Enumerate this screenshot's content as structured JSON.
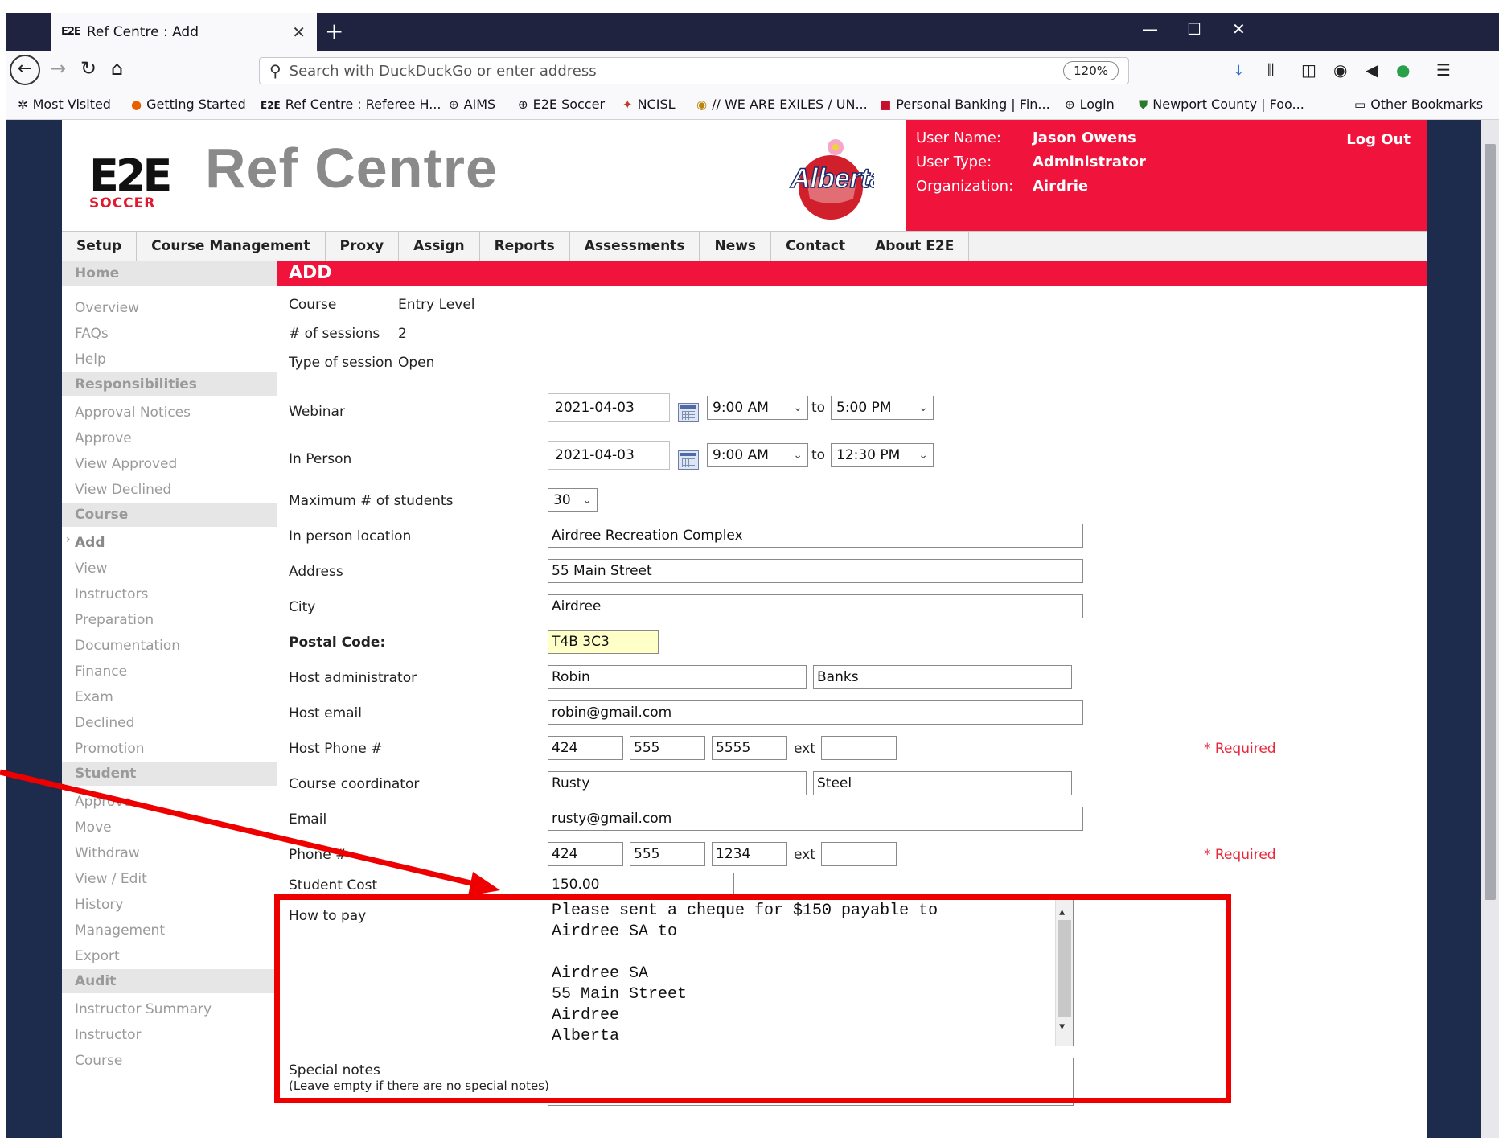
{
  "browser": {
    "tab_title": "Ref Centre : Add",
    "tab_favicon": "E2E",
    "url_placeholder": "Search with DuckDuckGo or enter address",
    "zoom": "120%",
    "bookmarks": [
      {
        "icon": "gear-icon",
        "label": "Most Visited"
      },
      {
        "icon": "firefox-icon",
        "label": "Getting Started"
      },
      {
        "icon": "e2e-icon",
        "label": "Ref Centre : Referee H..."
      },
      {
        "icon": "globe-icon",
        "label": "AIMS"
      },
      {
        "icon": "globe-icon",
        "label": "E2E Soccer"
      },
      {
        "icon": "ncisl-icon",
        "label": "NCISL"
      },
      {
        "icon": "exiles-icon",
        "label": "// WE ARE EXILES / UN..."
      },
      {
        "icon": "cibc-icon",
        "label": "Personal Banking | Fin..."
      },
      {
        "icon": "globe-icon",
        "label": "Login"
      },
      {
        "icon": "shield-icon",
        "label": "Newport County | Foo..."
      }
    ],
    "other_bookmarks": "Other Bookmarks"
  },
  "header": {
    "logo_letters": "E2E",
    "logo_sub": "SOCCER",
    "app_name": "Ref Centre",
    "province_logo": "Alberta",
    "user_name_label": "User Name:",
    "user_name": "Jason Owens",
    "user_type_label": "User Type:",
    "user_type": "Administrator",
    "org_label": "Organization:",
    "org": "Airdrie",
    "logout": "Log Out"
  },
  "nav": [
    "Setup",
    "Course Management",
    "Proxy",
    "Assign",
    "Reports",
    "Assessments",
    "News",
    "Contact",
    "About E2E"
  ],
  "sidebar": {
    "home": "Home",
    "items": [
      {
        "type": "item",
        "label": "Overview"
      },
      {
        "type": "item",
        "label": "FAQs"
      },
      {
        "type": "item",
        "label": "Help"
      },
      {
        "type": "header",
        "label": "Responsibilities"
      },
      {
        "type": "item",
        "label": "Approval Notices"
      },
      {
        "type": "item",
        "label": "Approve"
      },
      {
        "type": "item",
        "label": "View Approved"
      },
      {
        "type": "item",
        "label": "View Declined"
      },
      {
        "type": "header",
        "label": "Course"
      },
      {
        "type": "current",
        "label": "Add"
      },
      {
        "type": "item",
        "label": "View"
      },
      {
        "type": "item",
        "label": "Instructors"
      },
      {
        "type": "item",
        "label": "Preparation"
      },
      {
        "type": "item",
        "label": "Documentation"
      },
      {
        "type": "item",
        "label": "Finance"
      },
      {
        "type": "item",
        "label": "Exam"
      },
      {
        "type": "item",
        "label": "Declined"
      },
      {
        "type": "item",
        "label": "Promotion"
      },
      {
        "type": "header",
        "label": "Student"
      },
      {
        "type": "item",
        "label": "Approve"
      },
      {
        "type": "item",
        "label": "Move"
      },
      {
        "type": "item",
        "label": "Withdraw"
      },
      {
        "type": "item",
        "label": "View / Edit"
      },
      {
        "type": "item",
        "label": "History"
      },
      {
        "type": "item",
        "label": "Management"
      },
      {
        "type": "item",
        "label": "Export"
      },
      {
        "type": "header",
        "label": "Audit"
      },
      {
        "type": "item",
        "label": "Instructor Summary"
      },
      {
        "type": "item",
        "label": "Instructor"
      },
      {
        "type": "item",
        "label": "Course"
      }
    ]
  },
  "page_title": "ADD",
  "form": {
    "course_label": "Course",
    "course": "Entry Level",
    "sessions_label": "# of sessions",
    "sessions": "2",
    "session_type_label": "Type of session",
    "session_type": "Open",
    "webinar_label": "Webinar",
    "webinar_date": "2021-04-03",
    "webinar_from": "9:00 AM",
    "webinar_to": "5:00 PM",
    "to": "to",
    "inperson_label": "In Person",
    "inperson_date": "2021-04-03",
    "inperson_from": "9:00 AM",
    "inperson_to": "12:30 PM",
    "max_label": "Maximum # of students",
    "max": "30",
    "location_label": "In person location",
    "location": "Airdree Recreation Complex",
    "address_label": "Address",
    "address": "55 Main Street",
    "city_label": "City",
    "city": "Airdree",
    "postal_label": "Postal Code:",
    "postal": "T4B 3C3",
    "host_admin_label": "Host administrator",
    "host_first": "Robin",
    "host_last": "Banks",
    "host_email_label": "Host email",
    "host_email": "robin@gmail.com",
    "host_phone_label": "Host Phone #",
    "host_phone_1": "424",
    "host_phone_2": "555",
    "host_phone_3": "5555",
    "ext": "ext",
    "host_ext": "",
    "required": "* Required",
    "coord_label": "Course coordinator",
    "coord_first": "Rusty",
    "coord_last": "Steel",
    "email_label": "Email",
    "coord_email": "rusty@gmail.com",
    "phone_label": "Phone #",
    "phone_1": "424",
    "phone_2": "555",
    "phone_3": "1234",
    "coord_ext": "",
    "cost_label": "Student Cost",
    "cost": "150.00",
    "howpay_label": "How to pay",
    "howpay_lines": [
      "Please sent a cheque for $150 payable to",
      "Airdree SA to",
      "",
      "Airdree SA",
      "55 Main Street",
      "Airdree",
      "Alberta"
    ],
    "notes_label": "Special notes",
    "notes_hint": "(Leave empty if there are no special notes)",
    "notes": ""
  },
  "annotation": {
    "color": "#ee0000"
  }
}
